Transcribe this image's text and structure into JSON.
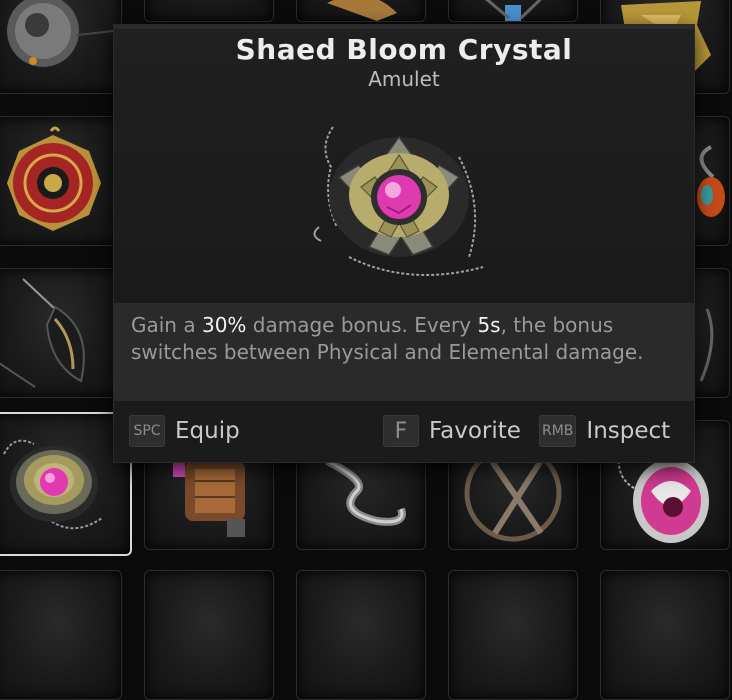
{
  "item": {
    "name": "Shaed Bloom Crystal",
    "type": "Amulet",
    "description": {
      "part1": "Gain a ",
      "value1": "30%",
      "part2": " damage bonus. Every ",
      "value2": "5s",
      "part3": ", the bonus switches between Physical and Elemental damage."
    }
  },
  "actions": [
    {
      "key": "SPC",
      "label": "Equip"
    },
    {
      "key": "F",
      "label": "Favorite"
    },
    {
      "key": "RMB",
      "label": "Inspect"
    }
  ],
  "inventory": {
    "slots": [
      {
        "icon": "spherical-amulet-icon"
      },
      {
        "icon": "amulet-icon"
      },
      {
        "icon": "amulet-icon"
      },
      {
        "icon": "amulet-icon"
      },
      {
        "icon": "gold-amulet-icon"
      },
      {
        "icon": "red-ornate-amulet-icon"
      },
      {
        "icon": "amulet-icon"
      },
      {
        "icon": "black-feather-amulet-icon"
      },
      {
        "icon": "amulet-icon"
      },
      {
        "icon": "shaed-bloom-crystal-icon"
      },
      {
        "icon": "copper-cylinder-amulet-icon"
      },
      {
        "icon": "silver-ribbon-amulet-icon"
      },
      {
        "icon": "crossed-sticks-amulet-icon"
      },
      {
        "icon": "pink-chain-amulet-icon"
      }
    ]
  },
  "colors": {
    "selected_border": "#d9d9d9",
    "highlight_text": "#f2f2f2",
    "crystal": "#e03ab0"
  }
}
